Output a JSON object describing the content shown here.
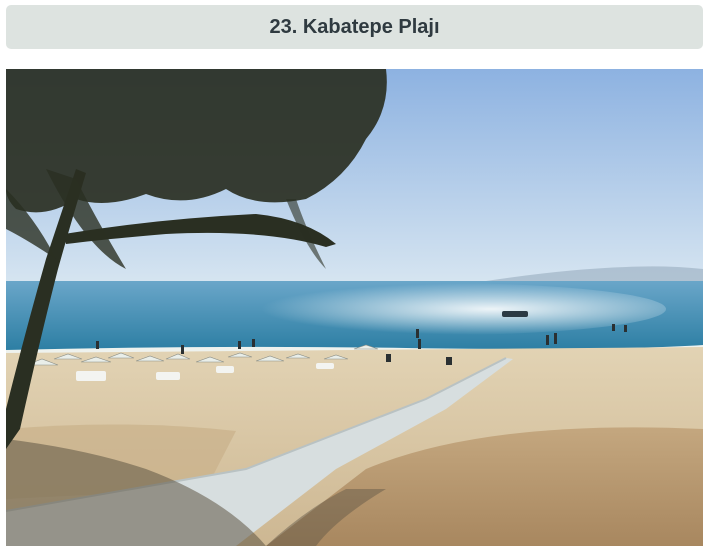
{
  "header": {
    "title": "23. Kabatepe Plajı"
  },
  "photo": {
    "subject": "beach-scene",
    "colors": {
      "sky_top": "#8fb3e2",
      "sky_bottom": "#dbe8f1",
      "sea": "#2f7fa4",
      "sand": "#d8c7a6",
      "dirt": "#b89b74",
      "boardwalk": "#d9dfe0",
      "tree": "#2a2f22"
    }
  }
}
